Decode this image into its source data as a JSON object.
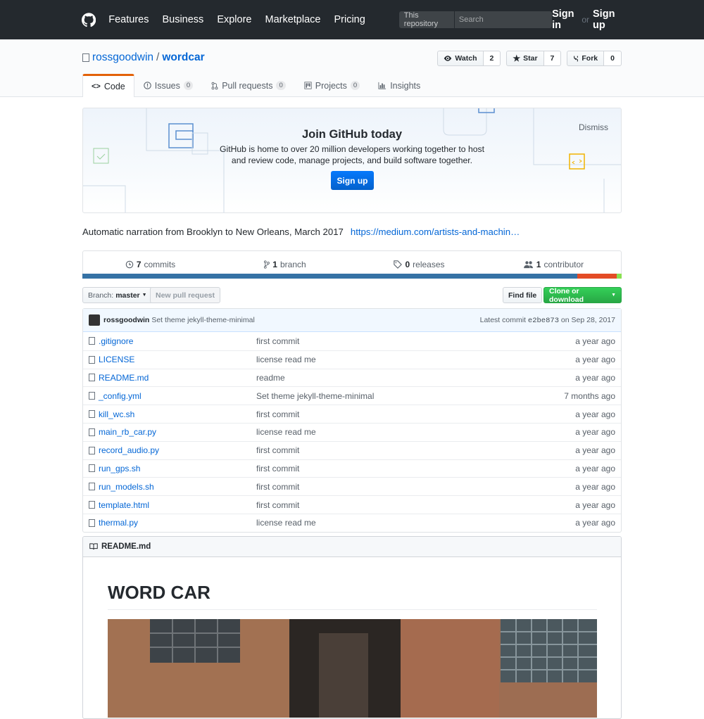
{
  "header": {
    "nav": [
      "Features",
      "Business",
      "Explore",
      "Marketplace",
      "Pricing"
    ],
    "search_scope": "This repository",
    "search_placeholder": "Search",
    "sign_in": "Sign in",
    "or": "or",
    "sign_up": "Sign up"
  },
  "repo": {
    "owner": "rossgoodwin",
    "slash": "/",
    "name": "wordcar",
    "watch_label": "Watch",
    "watch_count": "2",
    "star_label": "Star",
    "star_count": "7",
    "fork_label": "Fork",
    "fork_count": "0"
  },
  "tabs": {
    "code": "Code",
    "issues": "Issues",
    "issues_count": "0",
    "pulls": "Pull requests",
    "pulls_count": "0",
    "projects": "Projects",
    "projects_count": "0",
    "insights": "Insights"
  },
  "signup_prompt": {
    "title": "Join GitHub today",
    "text": "GitHub is home to over 20 million developers working together to host and review code, manage projects, and build software together.",
    "button": "Sign up",
    "dismiss": "Dismiss"
  },
  "description": {
    "text": "Automatic narration from Brooklyn to New Orleans, March 2017",
    "link": "https://medium.com/artists-and-machin…"
  },
  "numbers": {
    "commits_count": "7",
    "commits_label": "commits",
    "branch_count": "1",
    "branch_label": "branch",
    "releases_count": "0",
    "releases_label": "releases",
    "contributor_count": "1",
    "contributor_label": "contributor"
  },
  "language_colors": [
    "#3572A5",
    "#e34c26",
    "#89e051"
  ],
  "language_shares": [
    0.918,
    0.073,
    0.009
  ],
  "file_nav": {
    "branch_prefix": "Branch:",
    "branch_name": "master",
    "new_pr": "New pull request",
    "find_file": "Find file",
    "clone": "Clone or download"
  },
  "commit": {
    "author": "rossgoodwin",
    "message": "Set theme jekyll-theme-minimal",
    "latest_label": "Latest commit",
    "sha": "e2be873",
    "date": "on Sep 28, 2017"
  },
  "files": [
    {
      "name": ".gitignore",
      "message": "first commit",
      "age": "a year ago"
    },
    {
      "name": "LICENSE",
      "message": "license read me",
      "age": "a year ago"
    },
    {
      "name": "README.md",
      "message": "readme",
      "age": "a year ago"
    },
    {
      "name": "_config.yml",
      "message": "Set theme jekyll-theme-minimal",
      "age": "7 months ago"
    },
    {
      "name": "kill_wc.sh",
      "message": "first commit",
      "age": "a year ago"
    },
    {
      "name": "main_rb_car.py",
      "message": "license read me",
      "age": "a year ago"
    },
    {
      "name": "record_audio.py",
      "message": "first commit",
      "age": "a year ago"
    },
    {
      "name": "run_gps.sh",
      "message": "first commit",
      "age": "a year ago"
    },
    {
      "name": "run_models.sh",
      "message": "first commit",
      "age": "a year ago"
    },
    {
      "name": "template.html",
      "message": "first commit",
      "age": "a year ago"
    },
    {
      "name": "thermal.py",
      "message": "license read me",
      "age": "a year ago"
    }
  ],
  "readme": {
    "filename": "README.md",
    "heading": "WORD CAR"
  }
}
